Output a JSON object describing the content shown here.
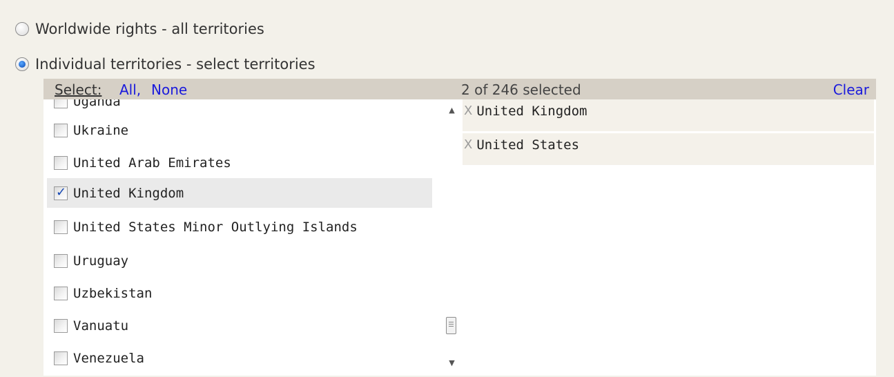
{
  "radios": [
    {
      "label": "Worldwide rights - all territories",
      "checked": false
    },
    {
      "label": "Individual territories - select territories",
      "checked": true
    }
  ],
  "header": {
    "select_label": "Select:",
    "all_link": "All,",
    "none_link": "None",
    "count": "2 of 246 selected",
    "clear": "Clear"
  },
  "available": [
    {
      "label": "Uganda",
      "checked": false,
      "cut": true
    },
    {
      "label": "Ukraine",
      "checked": false
    },
    {
      "label": "United Arab Emirates",
      "checked": false
    },
    {
      "label": "United Kingdom",
      "checked": true
    },
    {
      "label": "United States Minor Outlying Islands",
      "checked": false
    },
    {
      "label": "Uruguay",
      "checked": false
    },
    {
      "label": "Uzbekistan",
      "checked": false
    },
    {
      "label": "Vanuatu",
      "checked": false
    },
    {
      "label": "Venezuela",
      "checked": false
    }
  ],
  "selected": [
    {
      "remove": "X",
      "label": "United Kingdom"
    },
    {
      "remove": "X",
      "label": "United States"
    }
  ],
  "scrollbar": {
    "up_icon": "▲",
    "down_icon": "▼"
  }
}
